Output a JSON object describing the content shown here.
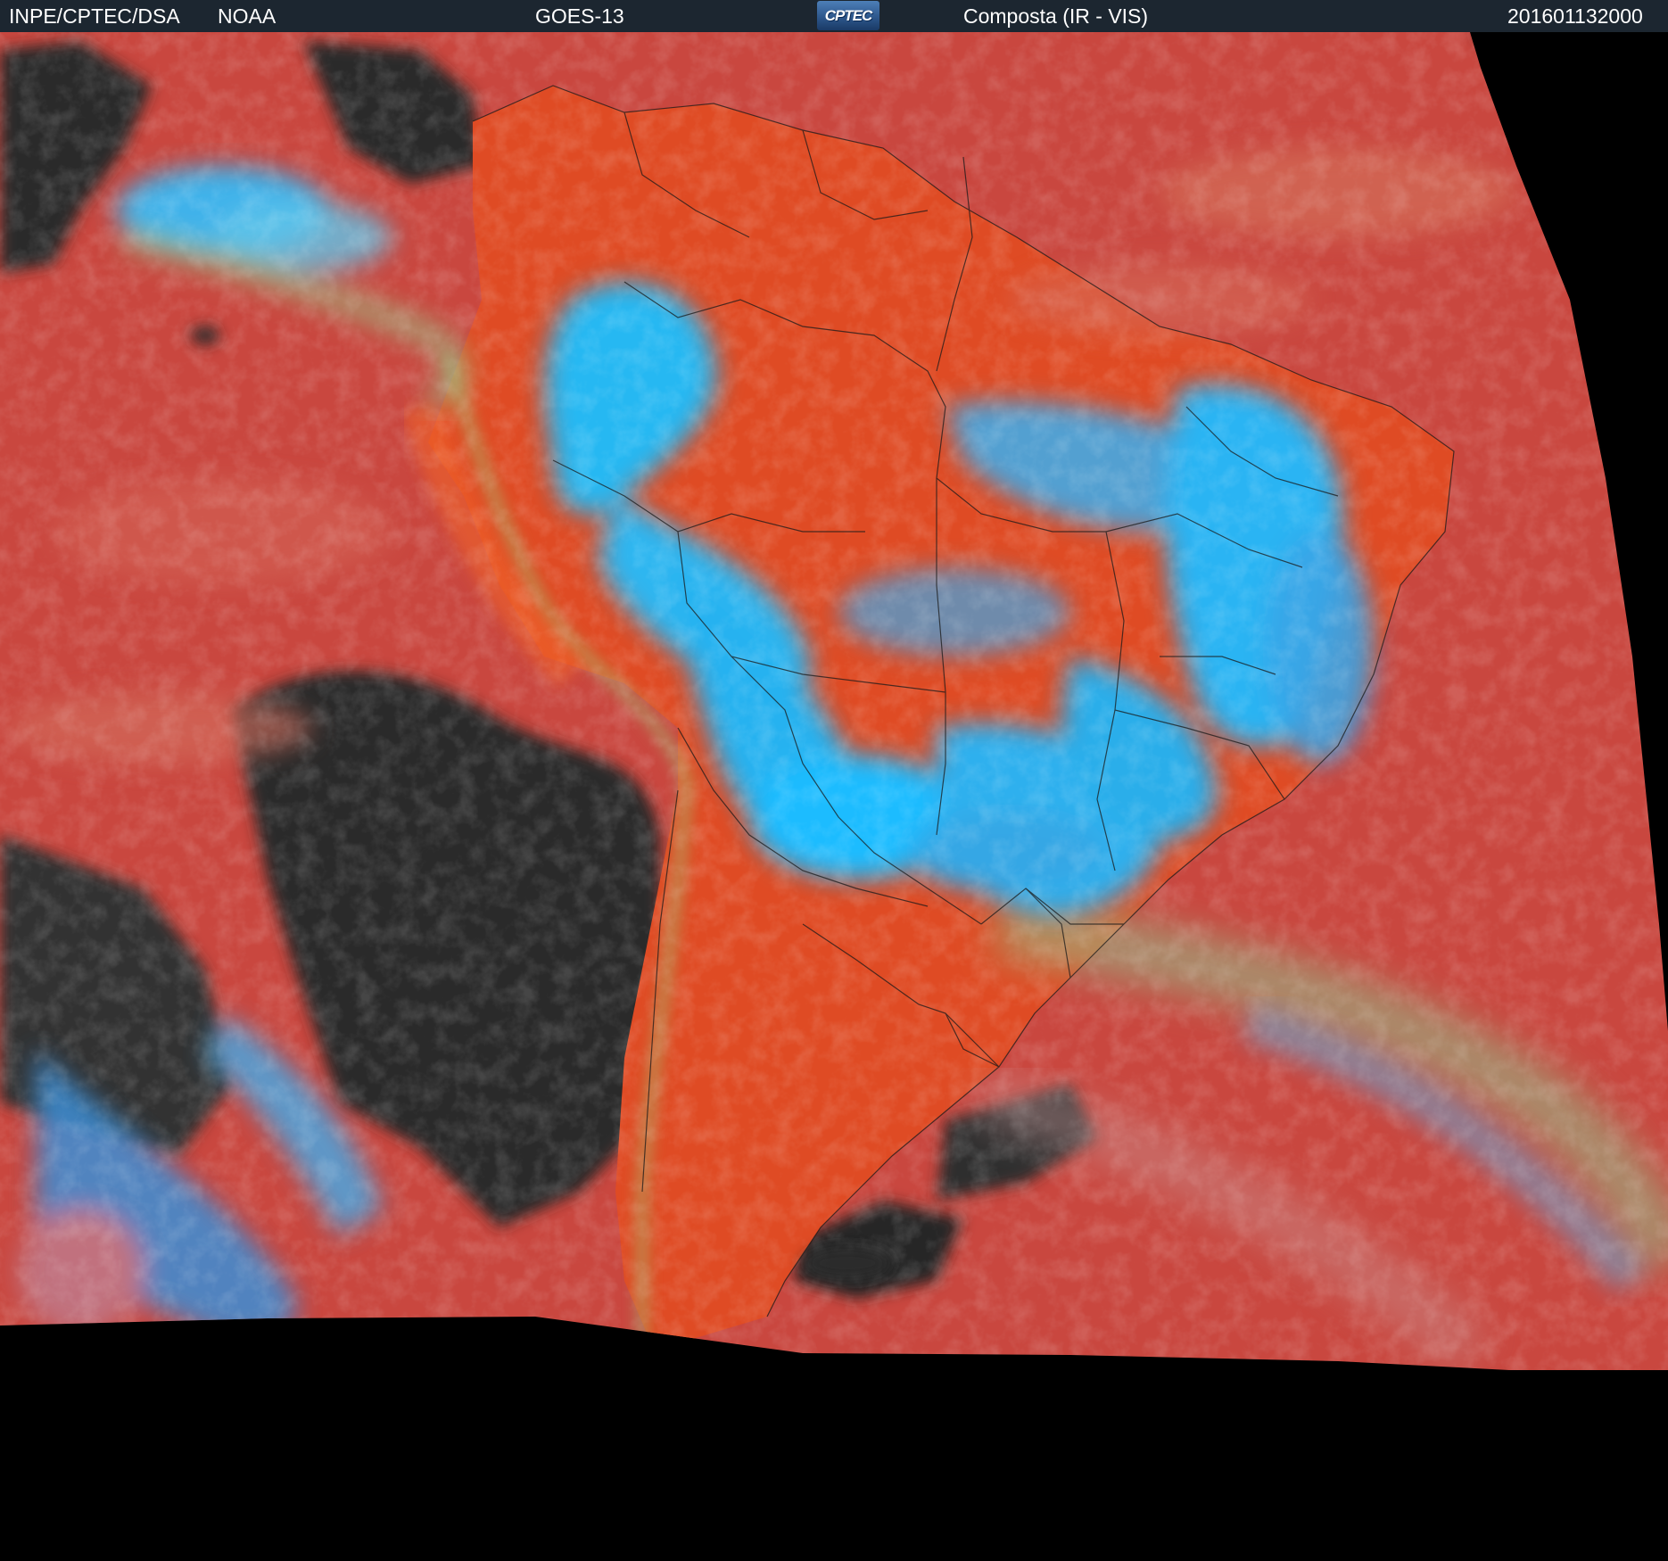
{
  "header": {
    "source": "INPE/CPTEC/DSA",
    "agency": "NOAA",
    "satellite": "GOES-13",
    "logo_text": "CPTEC",
    "product": "Composta (IR - VIS)",
    "timestamp": "201601132000"
  },
  "colors": {
    "header_bg": "#1c2630",
    "ocean_warm": "#c9473f",
    "land_warm": "#e04a22",
    "cold_cloud_top": "#18b4f5",
    "low_cloud": "#2c2c2c",
    "mid_cloud": "#8bd18a",
    "outside_disk": "#000000"
  }
}
